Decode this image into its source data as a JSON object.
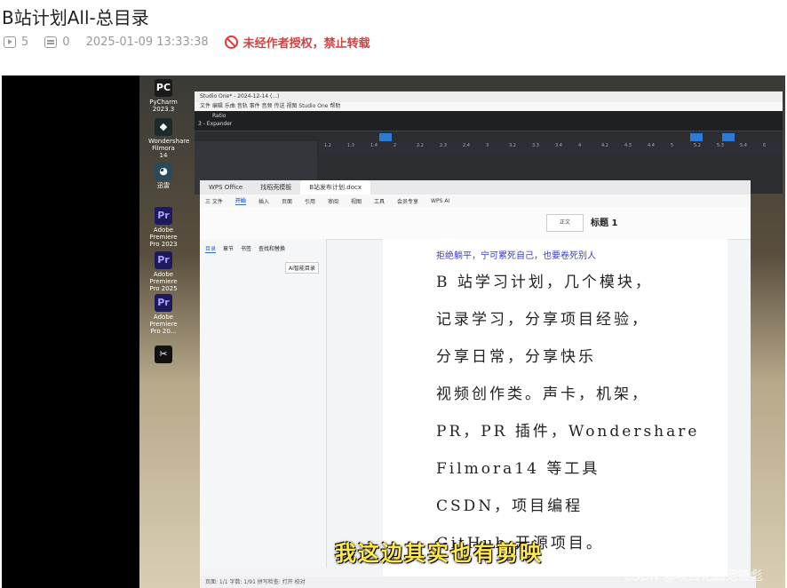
{
  "post": {
    "title": "B站计划All-总目录",
    "views": "5",
    "comments": "0",
    "date": "2025-01-09 13:33:38",
    "rights": "未经作者授权，禁止转载"
  },
  "desktop": {
    "icons": [
      {
        "label": "PyCharm 2023.3",
        "icon": "pycharm-icon",
        "glyph": "PC",
        "bg": "#1a1a1a"
      },
      {
        "label": "Wondershare Filmora 14",
        "icon": "filmora-icon",
        "glyph": "◆",
        "bg": "#1b2b2b"
      },
      {
        "label": "迅雷",
        "icon": "app-icon",
        "glyph": "◕",
        "bg": "#2a4a5a"
      },
      {
        "label": "Adobe Premiere Pro 2023",
        "icon": "premiere-icon",
        "glyph": "Pr",
        "bg": "#1d1a5c"
      },
      {
        "label": "Adobe Premiere Pro 2025",
        "icon": "premiere-icon",
        "glyph": "Pr",
        "bg": "#1d1a5c"
      },
      {
        "label": "Adobe Premiere Pro 20...",
        "icon": "premiere-icon",
        "glyph": "Pr",
        "bg": "#1d1a5c"
      },
      {
        "label": "",
        "icon": "capcut-icon",
        "glyph": "✂",
        "bg": "#111111"
      }
    ]
  },
  "studio": {
    "window_title": "Studio One* - 2024-12-14 (...)",
    "menu": "文件  编辑  乐曲  音轨  事件  音频  传送  视图  Studio One  帮助",
    "preset": "Ratio",
    "track": "3 - Expander",
    "ruler_marks": [
      "1.2",
      "1.3",
      "1.4",
      "2",
      "2.2",
      "2.3",
      "2.4",
      "3",
      "3.2",
      "3.3",
      "3.4",
      "4",
      "4.2",
      "4.3",
      "4.4",
      "5",
      "5.2",
      "5.3",
      "5.4",
      "6"
    ]
  },
  "wps": {
    "tabs": [
      "WPS Office",
      "找稻壳模板",
      "B站发布计划.docx"
    ],
    "menu": [
      "三 文件",
      "开始",
      "插入",
      "页面",
      "引用",
      "审阅",
      "视图",
      "工具",
      "会员专享",
      "WPS AI"
    ],
    "active_menu": "开始",
    "style_normal": "正文",
    "style_heading": "标题 1",
    "nav_tabs": [
      "目录",
      "章节",
      "书签",
      "查找和替换"
    ],
    "ai_button": "AI智能目录",
    "status": "页面: 1/1    字数: 1/91    拼写检查: 打开    校对"
  },
  "document": {
    "red_line": "拒绝躺平，宁可累死自己，也要卷死别人",
    "lines": [
      "B 站学习计划，几个模块，",
      "记录学习，分享项目经验，",
      "分享日常，分享快乐",
      "视频创作类。声卡，机架，",
      "PR，PR 插件，Wondershare",
      "Filmora14 等工具",
      "CSDN，项目编程",
      "GitHub 开源项目。"
    ]
  },
  "video": {
    "subtitle": "我这边其实也有剪映",
    "watermark": "CSDN @项目花园范德彪"
  }
}
